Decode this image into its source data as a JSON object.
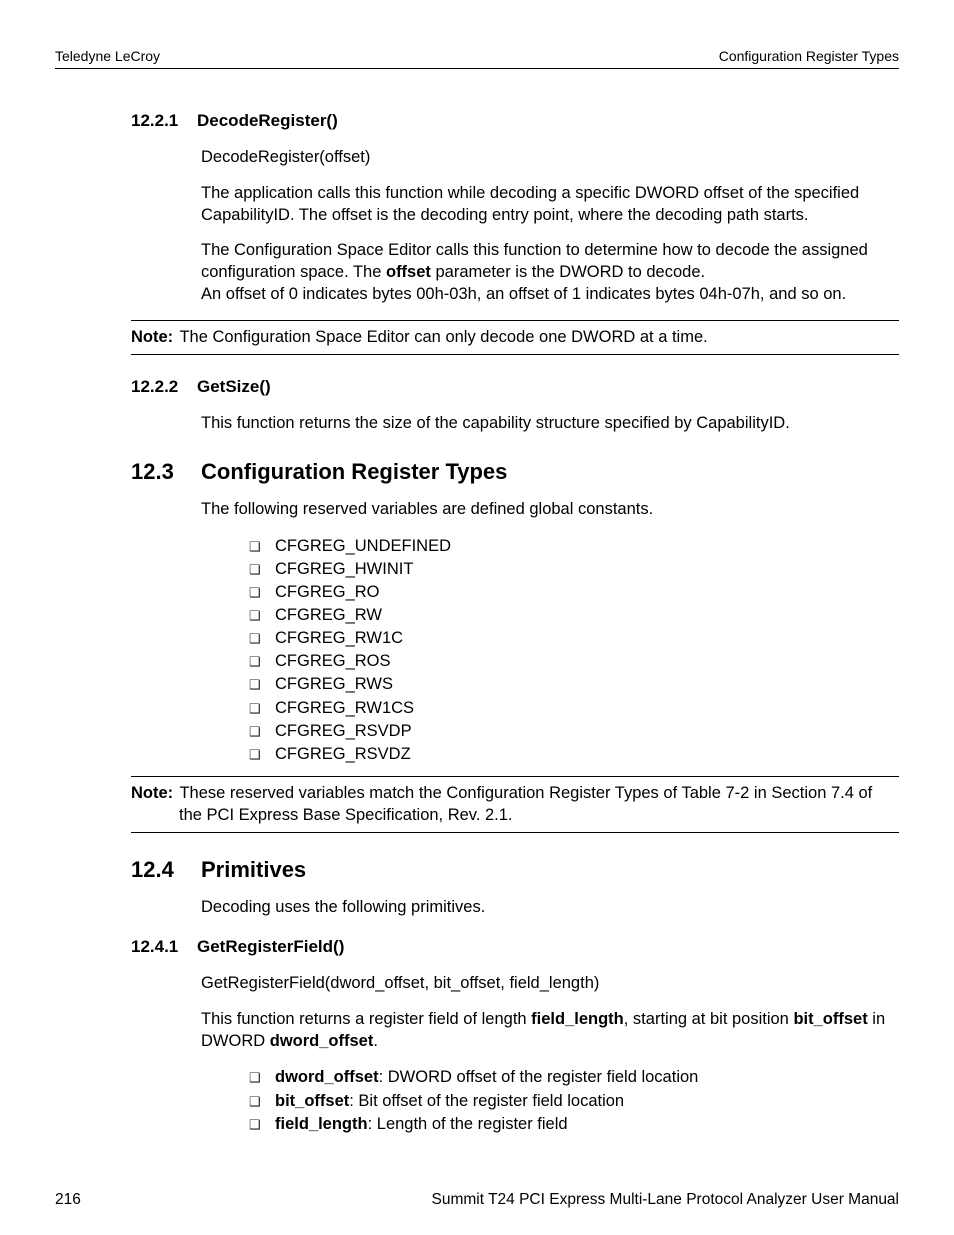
{
  "header": {
    "left": "Teledyne LeCroy",
    "right": "Configuration Register Types"
  },
  "s1221": {
    "num": "12.2.1",
    "title": "DecodeRegister()",
    "sig": "DecodeRegister(offset)",
    "p1": "The application calls this function while decoding a specific DWORD offset of the specified CapabilityID. The offset is the decoding entry point, where the decoding path starts.",
    "p2a": "The Configuration Space Editor calls this function to determine how to decode the assigned configuration space. The ",
    "p2b": "offset",
    "p2c": " parameter is the DWORD to decode.",
    "p3": "An offset of 0 indicates bytes 00h-03h, an offset of 1 indicates bytes 04h-07h, and so on."
  },
  "note1": {
    "label": "Note:",
    "text": " The Configuration Space Editor can only decode one DWORD at a time."
  },
  "s1222": {
    "num": "12.2.2",
    "title": "GetSize()",
    "p1": "This function returns the size of the capability structure specified by CapabilityID."
  },
  "s123": {
    "num": "12.3",
    "title": "Configuration Register Types",
    "p1": "The following reserved variables are defined global constants.",
    "items": {
      "i0": "CFGREG_UNDEFINED",
      "i1": "CFGREG_HWINIT",
      "i2": "CFGREG_RO",
      "i3": "CFGREG_RW",
      "i4": "CFGREG_RW1C",
      "i5": "CFGREG_ROS",
      "i6": "CFGREG_RWS",
      "i7": "CFGREG_RW1CS",
      "i8": "CFGREG_RSVDP",
      "i9": "CFGREG_RSVDZ"
    }
  },
  "note2": {
    "label": "Note:",
    "line1": " These reserved variables match the Configuration Register Types of Table 7-2 in Section 7.4 of",
    "line2": "the PCI Express Base Specification, Rev. 2.1."
  },
  "s124": {
    "num": "12.4",
    "title": "Primitives",
    "p1": "Decoding uses the following primitives."
  },
  "s1241": {
    "num": "12.4.1",
    "title": "GetRegisterField()",
    "sig": "GetRegisterField(dword_offset, bit_offset, field_length)",
    "p1a": "This function returns a register field of length ",
    "p1b": "field_length",
    "p1c": ", starting at bit position ",
    "p1d": "bit_offset",
    "p1e": " in DWORD ",
    "p1f": "dword_offset",
    "p1g": ".",
    "items": {
      "a_b": "dword_offset",
      "a_t": ": DWORD offset of the register field location",
      "b_b": "bit_offset",
      "b_t": ": Bit offset of the register field location",
      "c_b": "field_length",
      "c_t": ": Length of the register field"
    }
  },
  "footer": {
    "page": "216",
    "title": "Summit T24 PCI Express Multi-Lane Protocol Analyzer User Manual"
  }
}
